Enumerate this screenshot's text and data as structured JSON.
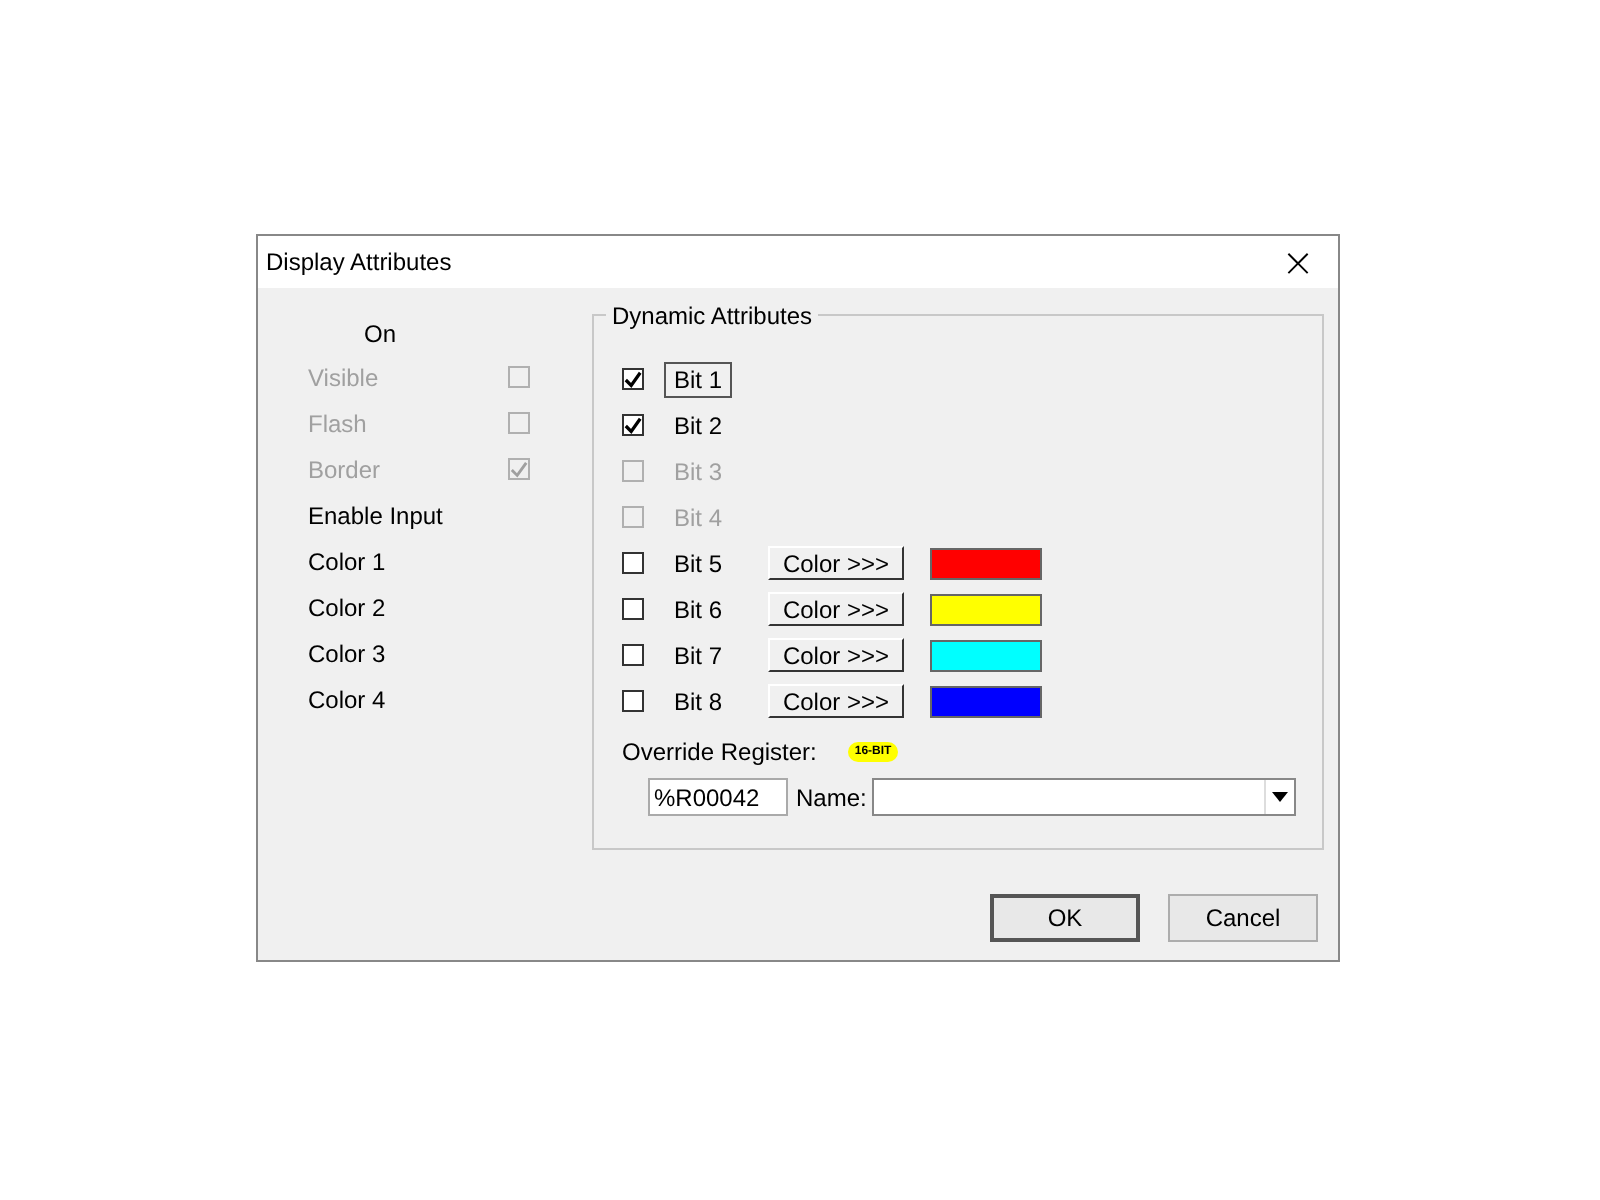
{
  "window": {
    "title": "Display Attributes",
    "close": "×"
  },
  "on_header": "On",
  "attributes": [
    {
      "kind": "checkbox",
      "label": "Visible",
      "checked": false,
      "disabled": true
    },
    {
      "kind": "checkbox",
      "label": "Flash",
      "checked": false,
      "disabled": true
    },
    {
      "kind": "checkbox",
      "label": "Border",
      "checked": true,
      "disabled": true
    },
    {
      "kind": "label",
      "label": "Enable Input",
      "disabled": false
    },
    {
      "kind": "label",
      "label": "Color 1",
      "disabled": false
    },
    {
      "kind": "label",
      "label": "Color 2",
      "disabled": false
    },
    {
      "kind": "label",
      "label": "Color 3",
      "disabled": false
    },
    {
      "kind": "label",
      "label": "Color 4",
      "disabled": false
    }
  ],
  "dynamic": {
    "title": "Dynamic Attributes",
    "bits": [
      {
        "label": "Bit 1",
        "checked": true,
        "disabled": false,
        "focused": true
      },
      {
        "label": "Bit 2",
        "checked": true,
        "disabled": false,
        "focused": false
      },
      {
        "label": "Bit 3",
        "checked": false,
        "disabled": true,
        "focused": false
      },
      {
        "label": "Bit 4",
        "checked": false,
        "disabled": true,
        "focused": false
      },
      {
        "label": "Bit 5",
        "checked": false,
        "disabled": false,
        "focused": false,
        "button": "Color >>>",
        "color": "#ff0000"
      },
      {
        "label": "Bit 6",
        "checked": false,
        "disabled": false,
        "focused": false,
        "button": "Color >>>",
        "color": "#ffff00"
      },
      {
        "label": "Bit 7",
        "checked": false,
        "disabled": false,
        "focused": false,
        "button": "Color >>>",
        "color": "#00ffff"
      },
      {
        "label": "Bit 8",
        "checked": false,
        "disabled": false,
        "focused": false,
        "button": "Color >>>",
        "color": "#0000ff"
      }
    ],
    "override_label": "Override Register:",
    "badge": "16-BIT",
    "register": "%R00042",
    "name_label": "Name:"
  },
  "buttons": [
    "OK",
    "Cancel"
  ]
}
